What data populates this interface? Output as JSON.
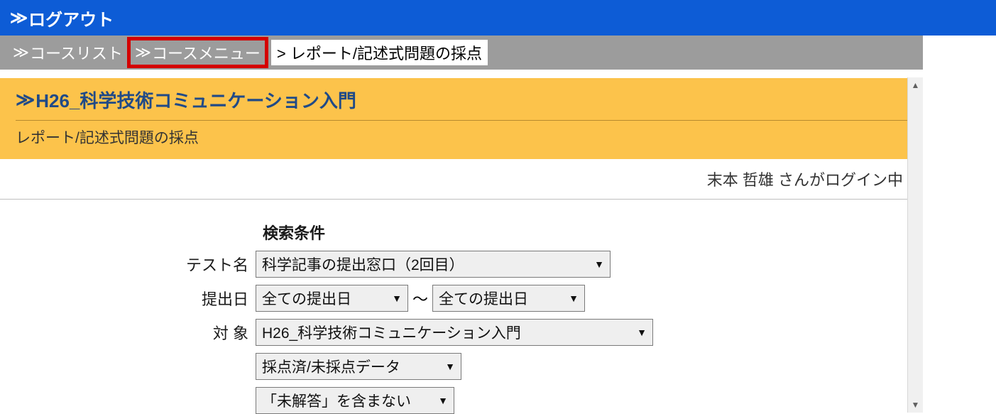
{
  "topbar": {
    "logout": "ログアウト"
  },
  "breadcrumb": {
    "item1": "コースリスト",
    "item2": "コースメニュー",
    "current": "レポート/記述式問題の採点"
  },
  "course": {
    "title": "H26_科学技術コミュニケーション入門",
    "subtitle": "レポート/記述式問題の採点"
  },
  "status": {
    "text": "末本 哲雄 さんがログイン中"
  },
  "form": {
    "heading": "検索条件",
    "labels": {
      "test_name": "テスト名",
      "submit_date": "提出日",
      "target": "対 象"
    },
    "values": {
      "test_name": "科学記事の提出窓口（2回目）",
      "date_from": "全ての提出日",
      "date_to": "全ての提出日",
      "target": "H26_科学技術コミュニケーション入門",
      "filter1": "採点済/未採点データ",
      "filter2": "「未解答」を含まない"
    },
    "tilde": "～"
  }
}
